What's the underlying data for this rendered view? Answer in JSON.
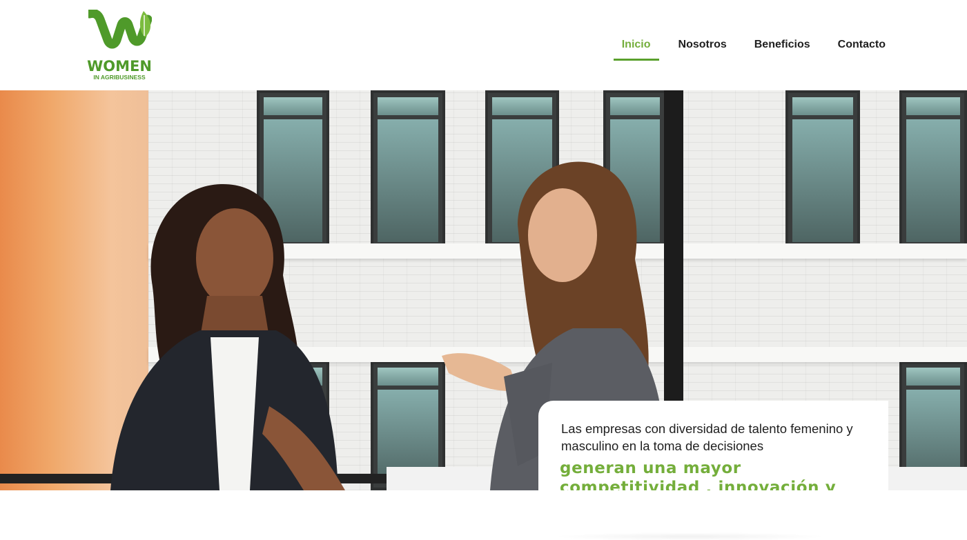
{
  "brand": {
    "logo_word": "WOMEN",
    "logo_sub": "IN AGRIBUSINESS",
    "green": "#5aa02c",
    "light_green": "#74ae3b"
  },
  "nav": {
    "items": [
      {
        "label": "Inicio",
        "active": true
      },
      {
        "label": "Nosotros",
        "active": false
      },
      {
        "label": "Beneficios",
        "active": false
      },
      {
        "label": "Contacto",
        "active": false
      }
    ]
  },
  "hero": {
    "image_subject": "two-women-talking-by-window",
    "card": {
      "lead": "Las empresas con diversidad de talento femenino y masculino en la toma de decisiones",
      "highlight": "generan una mayor competitividad , innovación y rentabilidad en sus resultados."
    }
  }
}
